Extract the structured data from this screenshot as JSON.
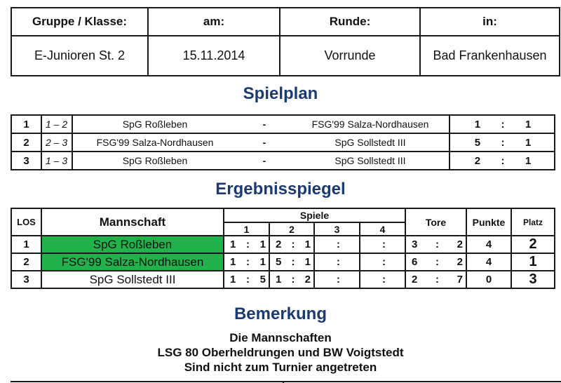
{
  "info": {
    "headers": [
      "Gruppe / Klasse:",
      "am:",
      "Runde:",
      "in:"
    ],
    "values": [
      "E-Junioren St. 2",
      "15.11.2014",
      "Vorrunde",
      "Bad Frankenhausen"
    ]
  },
  "spielplan": {
    "title": "Spielplan",
    "games": [
      {
        "nr": "1",
        "pairing": "1 – 2",
        "home": "SpG Roßleben",
        "dash": "-",
        "away": "FSG'99 Salza-Nordhausen",
        "goals_home": "1",
        "sep": ":",
        "goals_away": "1"
      },
      {
        "nr": "2",
        "pairing": "2 – 3",
        "home": "FSG'99 Salza-Nordhausen",
        "dash": "-",
        "away": "SpG Sollstedt III",
        "goals_home": "5",
        "sep": ":",
        "goals_away": "1"
      },
      {
        "nr": "3",
        "pairing": "1 – 3",
        "home": "SpG Roßleben",
        "dash": "-",
        "away": "SpG Sollstedt III",
        "goals_home": "2",
        "sep": ":",
        "goals_away": "1"
      }
    ]
  },
  "ergebnis": {
    "title": "Ergebnisspiegel",
    "headers": {
      "los": "LOS",
      "mannschaft": "Mannschaft",
      "spiele": "Spiele",
      "spiele_cols": [
        "1",
        "2",
        "3",
        "4"
      ],
      "tore": "Tore",
      "punkte": "Punkte",
      "platz": "Platz"
    },
    "highlight_color": "#22b24c",
    "rows": [
      {
        "los": "1",
        "team": "SpG Roßleben",
        "highlight": true,
        "spiele": [
          [
            "1",
            ":",
            "1"
          ],
          [
            "2",
            ":",
            "1"
          ],
          [
            "",
            ":",
            ""
          ],
          [
            "",
            ":",
            ""
          ]
        ],
        "tore": [
          "3",
          ":",
          "2"
        ],
        "punkte": "4",
        "platz": "2"
      },
      {
        "los": "2",
        "team": "FSG'99 Salza-Nordhausen",
        "highlight": true,
        "spiele": [
          [
            "1",
            ":",
            "1"
          ],
          [
            "5",
            ":",
            "1"
          ],
          [
            "",
            ":",
            ""
          ],
          [
            "",
            ":",
            ""
          ]
        ],
        "tore": [
          "6",
          ":",
          "2"
        ],
        "punkte": "4",
        "platz": "1"
      },
      {
        "los": "3",
        "team": "SpG Sollstedt III",
        "highlight": false,
        "spiele": [
          [
            "1",
            ":",
            "5"
          ],
          [
            "1",
            ":",
            "2"
          ],
          [
            "",
            ":",
            ""
          ],
          [
            "",
            ":",
            ""
          ]
        ],
        "tore": [
          "2",
          ":",
          "7"
        ],
        "punkte": "0",
        "platz": "3"
      }
    ]
  },
  "bemerkung": {
    "title": "Bemerkung",
    "lines": [
      "Die Mannschaften",
      "LSG 80 Oberheldrungen und BW Voigtstedt",
      "Sind nicht zum Turnier angetreten"
    ]
  },
  "colors": {
    "title": "#1b3a73",
    "highlight": "#22b24c"
  }
}
